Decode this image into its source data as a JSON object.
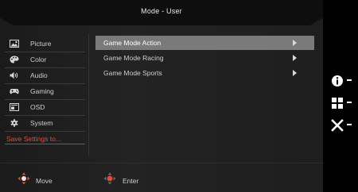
{
  "osd": {
    "title": "Mode - User",
    "sidebar": [
      {
        "label": "Picture",
        "icon": "picture-icon"
      },
      {
        "label": "Color",
        "icon": "palette-icon"
      },
      {
        "label": "Audio",
        "icon": "speaker-icon"
      },
      {
        "label": "Gaming",
        "icon": "gamepad-icon"
      },
      {
        "label": "OSD",
        "icon": "osd-icon"
      },
      {
        "label": "System",
        "icon": "gear-icon"
      }
    ],
    "save_label": "Save Settings to...",
    "menu": [
      {
        "label": "Game Mode Action",
        "selected": true
      },
      {
        "label": "Game Mode Racing",
        "selected": false
      },
      {
        "label": "Game Mode Sports",
        "selected": false
      }
    ],
    "footer": {
      "move_label": "Move",
      "enter_label": "Enter"
    }
  },
  "hotkeys": [
    {
      "icon": "info-icon",
      "label": "-"
    },
    {
      "icon": "grid-icon",
      "label": "-"
    },
    {
      "icon": "close-icon",
      "label": "-"
    }
  ],
  "colors": {
    "accent": "#e84a3a",
    "selected_bg": "#7a7a7a",
    "background": "#000000"
  }
}
